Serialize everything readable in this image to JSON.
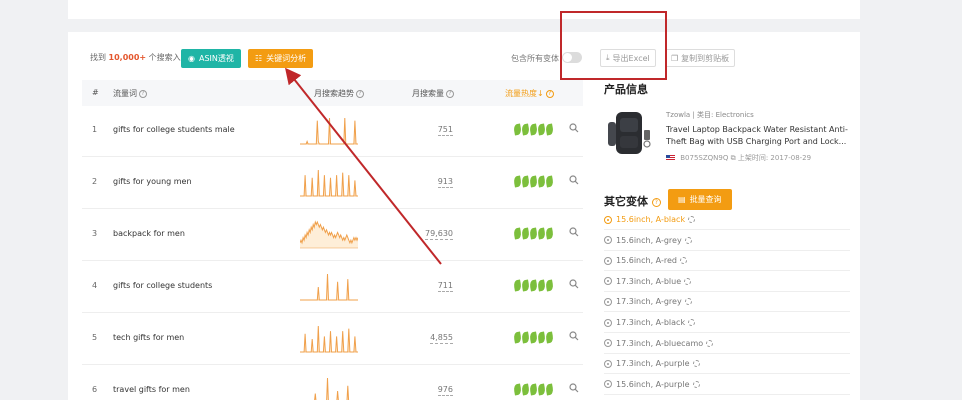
{
  "toolbar": {
    "found_prefix": "找到",
    "found_count": "10,000+",
    "found_suffix": "个搜索入口",
    "asin_button": "ASIN透视",
    "keyword_button": "关键词分析",
    "include_variants_label": "包含所有变体",
    "export_button": "导出Excel",
    "copy_button": "复制到剪贴板"
  },
  "table": {
    "columns": [
      "#",
      "流量词",
      "月搜索趋势",
      "月搜索量",
      "流量热度↓"
    ],
    "rows": [
      {
        "idx": "1",
        "keyword": "gifts for college students male",
        "volume": "751",
        "trend": [
          0,
          0,
          0,
          0,
          0,
          0,
          0,
          1,
          0,
          0,
          0,
          0,
          0,
          0,
          0,
          0,
          0,
          9,
          1,
          0,
          0,
          0,
          0,
          0,
          0,
          0,
          0,
          0,
          0,
          10,
          0,
          0,
          0,
          0,
          0,
          0,
          0,
          0,
          0,
          0,
          0,
          0,
          0,
          0,
          10,
          0,
          0,
          0,
          0,
          0,
          0,
          0,
          0,
          0,
          9,
          0,
          0,
          0
        ]
      },
      {
        "idx": "2",
        "keyword": "gifts for young men",
        "volume": "913",
        "trend": [
          0,
          0,
          0,
          0,
          0,
          8,
          0,
          0,
          0,
          0,
          0,
          0,
          7,
          0,
          0,
          0,
          0,
          0,
          10,
          0,
          0,
          0,
          0,
          0,
          8,
          0,
          0,
          0,
          0,
          0,
          7,
          0,
          0,
          0,
          0,
          0,
          8,
          0,
          0,
          0,
          0,
          0,
          9,
          0,
          0,
          0,
          0,
          0,
          8,
          0,
          0,
          0,
          0,
          0,
          6,
          0,
          0,
          0
        ]
      },
      {
        "idx": "3",
        "keyword": "backpack for men",
        "volume": "79,630",
        "trend": [
          2,
          3,
          2,
          4,
          3,
          5,
          4,
          6,
          5,
          7,
          6,
          8,
          7,
          9,
          8,
          10,
          9,
          10,
          9,
          8,
          9,
          8,
          7,
          8,
          7,
          6,
          7,
          6,
          5,
          6,
          5,
          6,
          5,
          4,
          5,
          4,
          5,
          6,
          5,
          4,
          5,
          4,
          3,
          4,
          3,
          4,
          5,
          4,
          3,
          2,
          3,
          2,
          3,
          4,
          3,
          4,
          3,
          4
        ]
      },
      {
        "idx": "4",
        "keyword": "gifts for college students",
        "volume": "711",
        "trend": [
          0,
          0,
          0,
          0,
          0,
          0,
          0,
          0,
          0,
          0,
          0,
          0,
          0,
          0,
          0,
          0,
          0,
          0,
          5,
          0,
          0,
          0,
          0,
          0,
          0,
          0,
          0,
          10,
          0,
          0,
          0,
          0,
          0,
          0,
          0,
          0,
          0,
          7,
          0,
          0,
          0,
          0,
          0,
          0,
          0,
          0,
          0,
          8,
          0,
          0,
          0,
          0,
          0,
          0,
          0,
          0,
          0,
          0
        ]
      },
      {
        "idx": "5",
        "keyword": "tech gifts for men",
        "volume": "4,855",
        "trend": [
          0,
          0,
          0,
          0,
          0,
          7,
          0,
          0,
          0,
          0,
          0,
          0,
          5,
          0,
          0,
          0,
          0,
          0,
          10,
          0,
          0,
          0,
          0,
          0,
          6,
          0,
          0,
          0,
          0,
          0,
          8,
          0,
          0,
          0,
          0,
          0,
          6,
          0,
          0,
          0,
          0,
          0,
          8,
          0,
          0,
          0,
          0,
          0,
          9,
          0,
          0,
          0,
          0,
          0,
          6,
          0,
          0,
          0
        ]
      },
      {
        "idx": "6",
        "keyword": "travel gifts for men",
        "volume": "976",
        "trend": [
          0,
          0,
          0,
          0,
          0,
          0,
          0,
          0,
          0,
          0,
          0,
          0,
          0,
          0,
          0,
          4,
          0,
          0,
          0,
          0,
          0,
          0,
          0,
          0,
          0,
          0,
          0,
          10,
          0,
          0,
          0,
          0,
          0,
          0,
          0,
          0,
          0,
          5,
          0,
          0,
          0,
          0,
          0,
          0,
          0,
          0,
          0,
          7,
          0,
          0,
          0,
          0,
          0,
          0,
          0,
          0,
          0,
          0
        ]
      }
    ]
  },
  "product": {
    "section_title": "产品信息",
    "brand": "Tzowla",
    "category": "类目: Electronics",
    "title": "Travel Laptop Backpack Water Resistant Anti-Theft Bag with USB Charging Port and Lock...",
    "asin": "B075SZQN9Q",
    "listed_date": "上架时间: 2017-08-29"
  },
  "variants": {
    "section_title": "其它变体",
    "batch_button": "批量查询",
    "items": [
      "15.6inch, A-black",
      "15.6inch, A-grey",
      "15.6inch, A-red",
      "17.3inch, A-blue",
      "17.3inch, A-grey",
      "17.3inch, A-black",
      "17.3inch, A-bluecamo",
      "17.3inch, A-purple",
      "15.6inch, A-purple"
    ]
  },
  "colors": {
    "accent": "#f39c12",
    "teal": "#1fb5a6",
    "annotation_red": "#c0282a",
    "leaf_green": "#7cbf3c"
  }
}
